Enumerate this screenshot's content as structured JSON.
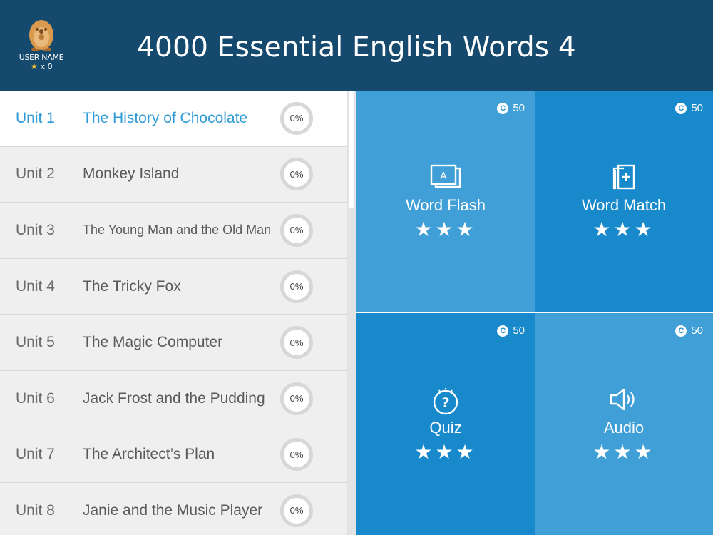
{
  "header": {
    "title": "4000 Essential English Words 4",
    "user_name": "USER NAME",
    "star_count": "x 0"
  },
  "units": [
    {
      "num": "Unit 1",
      "title": "The History of Chocolate",
      "progress": "0%",
      "selected": true
    },
    {
      "num": "Unit 2",
      "title": "Monkey Island",
      "progress": "0%"
    },
    {
      "num": "Unit 3",
      "title": "The Young Man and the Old Man",
      "progress": "0%"
    },
    {
      "num": "Unit 4",
      "title": "The Tricky Fox",
      "progress": "0%"
    },
    {
      "num": "Unit 5",
      "title": "The Magic Computer",
      "progress": "0%"
    },
    {
      "num": "Unit 6",
      "title": "Jack Frost and the Pudding",
      "progress": "0%"
    },
    {
      "num": "Unit 7",
      "title": "The Architect’s Plan",
      "progress": "0%"
    },
    {
      "num": "Unit 8",
      "title": "Janie and the Music Player",
      "progress": "0%"
    }
  ],
  "activities": [
    {
      "label": "Word Flash",
      "coins": "50",
      "stars": "★★★",
      "icon": "flashcard-icon"
    },
    {
      "label": "Word Match",
      "coins": "50",
      "stars": "★★★",
      "icon": "card-plus-icon"
    },
    {
      "label": "Quiz",
      "coins": "50",
      "stars": "★★★",
      "icon": "question-icon"
    },
    {
      "label": "Audio",
      "coins": "50",
      "stars": "★★★",
      "icon": "speaker-icon"
    }
  ],
  "colors": {
    "header_bg": "#154a6e",
    "tile_light": "#409fd6",
    "tile_dark": "#1889cb",
    "selected_text": "#2f9ad6",
    "user_star": "#f6c232"
  }
}
